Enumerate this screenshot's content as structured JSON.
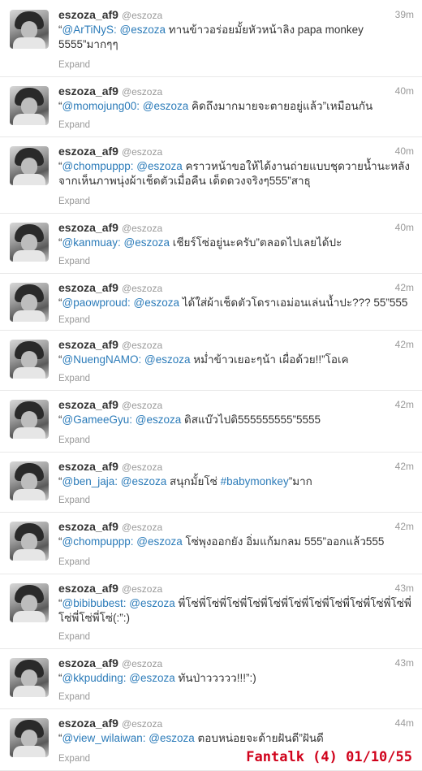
{
  "profile": {
    "fullname": "eszoza_af9",
    "username": "@eszoza"
  },
  "expand_label": "Expand",
  "tweets": [
    {
      "time": "39m",
      "segments": [
        {
          "t": "text",
          "v": "“"
        },
        {
          "t": "mention",
          "v": "@ArTiNyS:"
        },
        {
          "t": "text",
          "v": " "
        },
        {
          "t": "mention",
          "v": "@eszoza"
        },
        {
          "t": "text",
          "v": " ทานข้าวอร่อยมั้ยหัวหน้าลิง papa monkey 5555”มากๆๆ"
        }
      ]
    },
    {
      "time": "40m",
      "segments": [
        {
          "t": "text",
          "v": "“"
        },
        {
          "t": "mention",
          "v": "@momojung00:"
        },
        {
          "t": "text",
          "v": " "
        },
        {
          "t": "mention",
          "v": "@eszoza"
        },
        {
          "t": "text",
          "v": " คิดถึงมากมายจะตายอยู่แล้ว”เหมือนกัน"
        }
      ]
    },
    {
      "time": "40m",
      "segments": [
        {
          "t": "text",
          "v": "“"
        },
        {
          "t": "mention",
          "v": "@chompuppp:"
        },
        {
          "t": "text",
          "v": " "
        },
        {
          "t": "mention",
          "v": "@eszoza"
        },
        {
          "t": "text",
          "v": " คราวหน้าขอให้ได้งานถ่ายแบบชุดวายน้ำนะหลังจากเห็นภาพนุ่งผ้าเช็ดตัวเมื่อคืน เด็ดดวงจริงๆ555”สาธุ"
        }
      ]
    },
    {
      "time": "40m",
      "segments": [
        {
          "t": "text",
          "v": "“"
        },
        {
          "t": "mention",
          "v": "@kanmuay:"
        },
        {
          "t": "text",
          "v": " "
        },
        {
          "t": "mention",
          "v": "@eszoza"
        },
        {
          "t": "text",
          "v": " เชียร์โซ่อยู่นะครับ”ตลอดไปเลยได้ปะ"
        }
      ]
    },
    {
      "time": "42m",
      "segments": [
        {
          "t": "text",
          "v": "“"
        },
        {
          "t": "mention",
          "v": "@paowproud:"
        },
        {
          "t": "text",
          "v": " "
        },
        {
          "t": "mention",
          "v": "@eszoza"
        },
        {
          "t": "text",
          "v": " ได้ใส่ผ้าเช็ดตัวโดราเอม่อนเล่นน้ำปะ??? 55”555"
        }
      ]
    },
    {
      "time": "42m",
      "segments": [
        {
          "t": "text",
          "v": "“"
        },
        {
          "t": "mention",
          "v": "@NuengNAMO:"
        },
        {
          "t": "text",
          "v": " "
        },
        {
          "t": "mention",
          "v": "@eszoza"
        },
        {
          "t": "text",
          "v": " หม่ำข้าวเยอะๆน้า เผื่อด้วย!!”โอเค"
        }
      ]
    },
    {
      "time": "42m",
      "segments": [
        {
          "t": "text",
          "v": "“"
        },
        {
          "t": "mention",
          "v": "@GameeGyu:"
        },
        {
          "t": "text",
          "v": " "
        },
        {
          "t": "mention",
          "v": "@eszoza"
        },
        {
          "t": "text",
          "v": " ดิสแบ๊วไปดิ555555555”5555"
        }
      ]
    },
    {
      "time": "42m",
      "segments": [
        {
          "t": "text",
          "v": "“"
        },
        {
          "t": "mention",
          "v": "@ben_jaja:"
        },
        {
          "t": "text",
          "v": " "
        },
        {
          "t": "mention",
          "v": "@eszoza"
        },
        {
          "t": "text",
          "v": " สนุกมั้ยโซ่ "
        },
        {
          "t": "mention",
          "v": "#babymonkey"
        },
        {
          "t": "text",
          "v": "”มาก"
        }
      ]
    },
    {
      "time": "42m",
      "segments": [
        {
          "t": "text",
          "v": "“"
        },
        {
          "t": "mention",
          "v": "@chompuppp:"
        },
        {
          "t": "text",
          "v": " "
        },
        {
          "t": "mention",
          "v": "@eszoza"
        },
        {
          "t": "text",
          "v": " โซ่พุงออกยัง อิ่มแก้มกลม 555”ออกแล้ว555"
        }
      ]
    },
    {
      "time": "43m",
      "segments": [
        {
          "t": "text",
          "v": "“"
        },
        {
          "t": "mention",
          "v": "@bibibubest:"
        },
        {
          "t": "text",
          "v": " "
        },
        {
          "t": "mention",
          "v": "@eszoza"
        },
        {
          "t": "text",
          "v": " พี่โซ่พี่โซ่พี่โซ่พี่โซ่พี่โซ่พี่โซ่พี่โซ่พี่โซ่พี่โซ่พี่โซ่พี่โซ่พี่โซ่พี่โซ่พี่โซ่(:”:)"
        }
      ]
    },
    {
      "time": "43m",
      "segments": [
        {
          "t": "text",
          "v": "“"
        },
        {
          "t": "mention",
          "v": "@kkpudding:"
        },
        {
          "t": "text",
          "v": " "
        },
        {
          "t": "mention",
          "v": "@eszoza"
        },
        {
          "t": "text",
          "v": " ทันป่าววววว!!!”:)"
        }
      ]
    },
    {
      "time": "44m",
      "segments": [
        {
          "t": "text",
          "v": "“"
        },
        {
          "t": "mention",
          "v": "@view_wilaiwan:"
        },
        {
          "t": "text",
          "v": " "
        },
        {
          "t": "mention",
          "v": "@eszoza"
        },
        {
          "t": "text",
          "v": " ตอบหน่อยจะด้ายฝันดี”ฝันดี"
        }
      ]
    }
  ],
  "watermark": "Fantalk (4) 01/10/55"
}
